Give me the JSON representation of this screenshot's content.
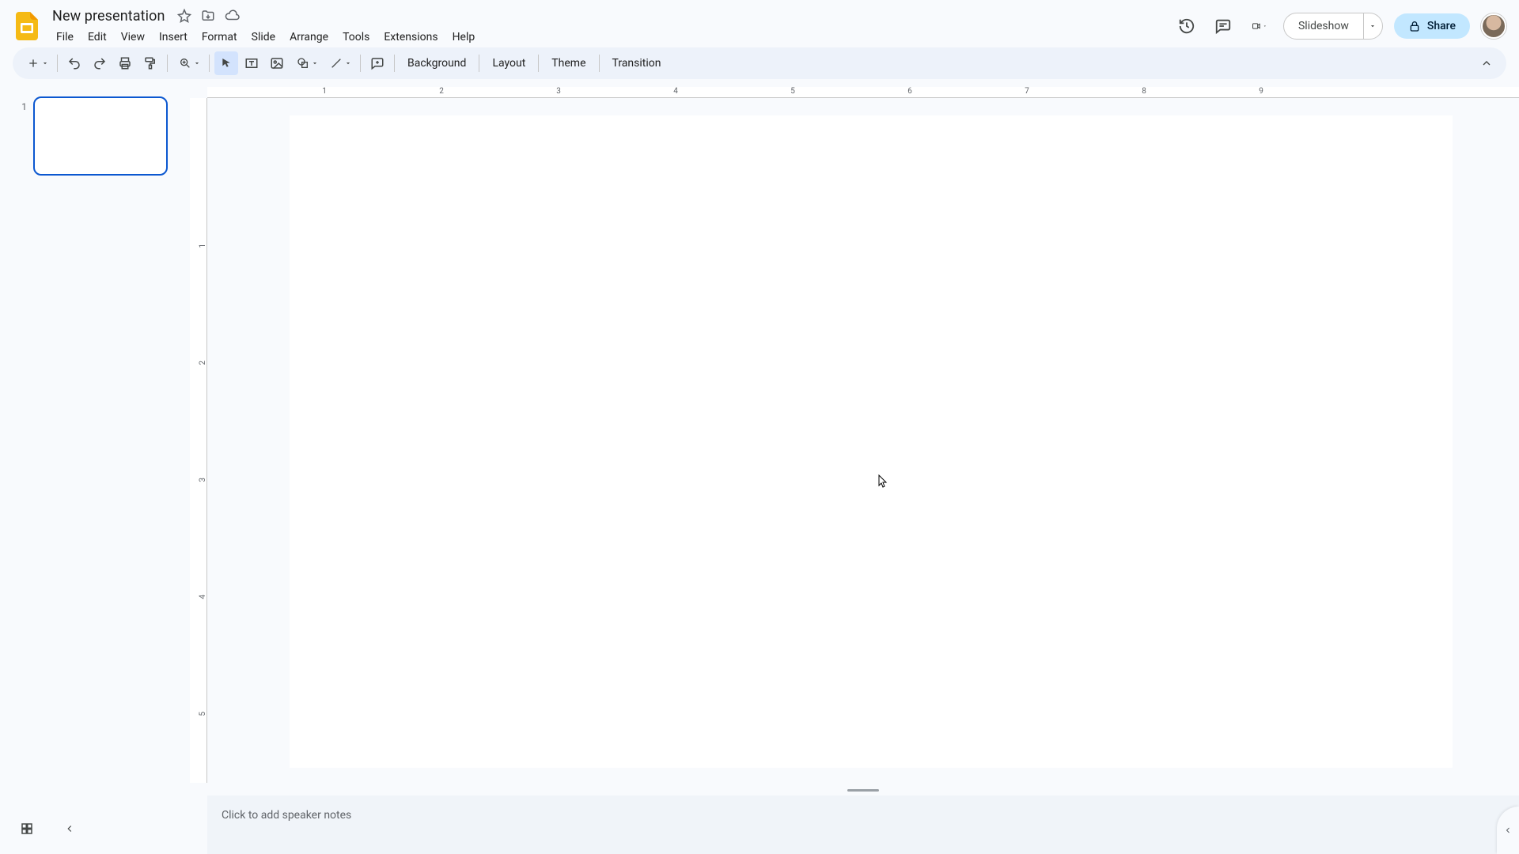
{
  "header": {
    "doc_title": "New presentation",
    "menus": [
      "File",
      "Edit",
      "View",
      "Insert",
      "Format",
      "Slide",
      "Arrange",
      "Tools",
      "Extensions",
      "Help"
    ],
    "slideshow_label": "Slideshow",
    "share_label": "Share"
  },
  "toolbar": {
    "background_label": "Background",
    "layout_label": "Layout",
    "theme_label": "Theme",
    "transition_label": "Transition"
  },
  "filmstrip": {
    "slides": [
      {
        "number": "1"
      }
    ]
  },
  "rulers": {
    "horizontal_labels": [
      "1",
      "2",
      "3",
      "4",
      "5",
      "6",
      "7",
      "8",
      "9"
    ],
    "vertical_labels": [
      "1",
      "2",
      "3",
      "4",
      "5"
    ]
  },
  "notes": {
    "placeholder": "Click to add speaker notes"
  }
}
